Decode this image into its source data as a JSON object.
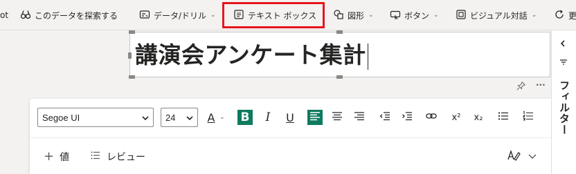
{
  "ribbon": {
    "items": [
      {
        "label": "ot",
        "has_chevron": false
      },
      {
        "label": "このデータを探索する",
        "icon": "binoculars-icon"
      },
      {
        "label": "データ/ドリル",
        "icon": "data-drill-icon",
        "has_chevron": true
      },
      {
        "label": "テキスト ボックス",
        "icon": "textbox-icon",
        "highlighted": true
      },
      {
        "label": "図形",
        "icon": "shapes-icon",
        "has_chevron": true
      },
      {
        "label": "ボタン",
        "icon": "button-icon",
        "has_chevron": true
      },
      {
        "label": "ビジュアル対話",
        "icon": "visual-interactions-icon",
        "has_chevron": true
      },
      {
        "label": "更",
        "icon": "refresh-icon"
      }
    ],
    "highlight_color": "#e8141c"
  },
  "textbox": {
    "content": "講演会アンケート集計"
  },
  "format_toolbar": {
    "font_family": "Segoe UI",
    "font_size": "24",
    "font_color_label": "A",
    "bold_label": "B",
    "italic_label": "I",
    "underline_label": "U",
    "superscript_label": "x²",
    "subscript_label": "x₂",
    "active_color": "#0e7a5f"
  },
  "secondary_toolbar": {
    "add_value_label": "値",
    "review_label": "レビュー"
  },
  "filter_pane": {
    "title": "フィルター"
  }
}
